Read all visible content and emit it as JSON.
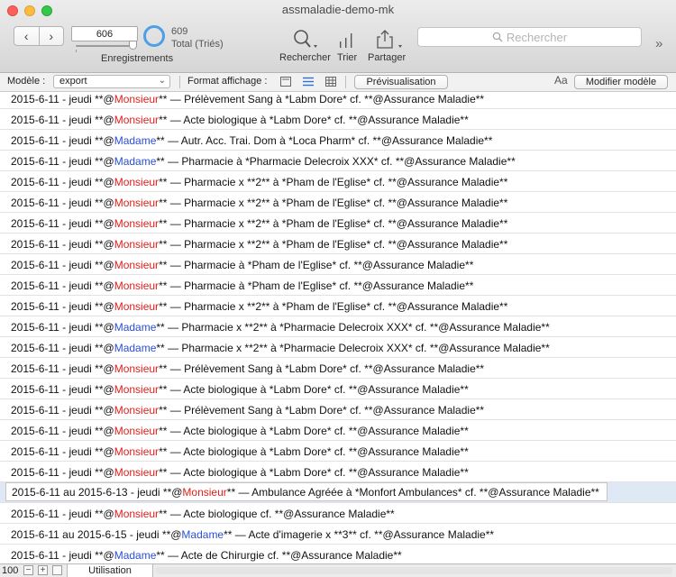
{
  "window": {
    "title": "assmaladie-demo-mk"
  },
  "toolbar": {
    "current_record": "606",
    "records_label": "Enregistrements",
    "total_count": "609",
    "total_label": "Total (Triés)",
    "search_label": "Rechercher",
    "sort_label": "Trier",
    "share_label": "Partager",
    "search_placeholder": "Rechercher",
    "overflow": "»"
  },
  "layoutbar": {
    "model_label": "Modèle :",
    "model_value": "export",
    "format_label": "Format affichage :",
    "preview_button": "Prévisualisation",
    "font_icon_text": "Aa",
    "edit_model_button": "Modifier modèle"
  },
  "records": [
    {
      "pre": "2015-6-11 - jeudi **@",
      "who": "Monsieur",
      "sex": "m",
      "post": "** — Prélèvement Sang à *Labm Dore* cf. **@Assurance Maladie**"
    },
    {
      "pre": "2015-6-11 - jeudi **@",
      "who": "Monsieur",
      "sex": "m",
      "post": "** — Acte biologique à *Labm Dore* cf. **@Assurance Maladie**"
    },
    {
      "pre": "2015-6-11 - jeudi **@",
      "who": "Madame",
      "sex": "f",
      "post": "** — Autr. Acc. Trai. Dom à *Loca Pharm* cf. **@Assurance Maladie**"
    },
    {
      "pre": "2015-6-11 - jeudi **@",
      "who": "Madame",
      "sex": "f",
      "post": "** — Pharmacie à *Pharmacie Delecroix XXX* cf. **@Assurance Maladie**"
    },
    {
      "pre": "2015-6-11 - jeudi **@",
      "who": "Monsieur",
      "sex": "m",
      "post": "** — Pharmacie x **2** à *Pham de l'Eglise* cf. **@Assurance Maladie**"
    },
    {
      "pre": "2015-6-11 - jeudi **@",
      "who": "Monsieur",
      "sex": "m",
      "post": "** — Pharmacie x **2** à *Pham de l'Eglise* cf. **@Assurance Maladie**"
    },
    {
      "pre": "2015-6-11 - jeudi **@",
      "who": "Monsieur",
      "sex": "m",
      "post": "** — Pharmacie x **2** à *Pham de l'Eglise* cf. **@Assurance Maladie**"
    },
    {
      "pre": "2015-6-11 - jeudi **@",
      "who": "Monsieur",
      "sex": "m",
      "post": "** — Pharmacie x **2** à *Pham de l'Eglise* cf. **@Assurance Maladie**"
    },
    {
      "pre": "2015-6-11 - jeudi **@",
      "who": "Monsieur",
      "sex": "m",
      "post": "** — Pharmacie à *Pham de l'Eglise* cf. **@Assurance Maladie**"
    },
    {
      "pre": "2015-6-11 - jeudi **@",
      "who": "Monsieur",
      "sex": "m",
      "post": "** — Pharmacie à *Pham de l'Eglise* cf. **@Assurance Maladie**"
    },
    {
      "pre": "2015-6-11 - jeudi **@",
      "who": "Monsieur",
      "sex": "m",
      "post": "** — Pharmacie x **2** à *Pham de l'Eglise* cf. **@Assurance Maladie**"
    },
    {
      "pre": "2015-6-11 - jeudi **@",
      "who": "Madame",
      "sex": "f",
      "post": "** — Pharmacie x **2** à *Pharmacie Delecroix XXX* cf. **@Assurance Maladie**"
    },
    {
      "pre": "2015-6-11 - jeudi **@",
      "who": "Madame",
      "sex": "f",
      "post": "** — Pharmacie x **2** à *Pharmacie Delecroix XXX* cf. **@Assurance Maladie**"
    },
    {
      "pre": "2015-6-11 - jeudi **@",
      "who": "Monsieur",
      "sex": "m",
      "post": "** — Prélèvement Sang à *Labm Dore* cf. **@Assurance Maladie**"
    },
    {
      "pre": "2015-6-11 - jeudi **@",
      "who": "Monsieur",
      "sex": "m",
      "post": "** — Acte biologique à *Labm Dore* cf. **@Assurance Maladie**"
    },
    {
      "pre": "2015-6-11 - jeudi **@",
      "who": "Monsieur",
      "sex": "m",
      "post": "** — Prélèvement Sang à *Labm Dore* cf. **@Assurance Maladie**"
    },
    {
      "pre": "2015-6-11 - jeudi **@",
      "who": "Monsieur",
      "sex": "m",
      "post": "** — Acte biologique à *Labm Dore* cf. **@Assurance Maladie**"
    },
    {
      "pre": "2015-6-11 - jeudi **@",
      "who": "Monsieur",
      "sex": "m",
      "post": "** — Acte biologique à *Labm Dore* cf. **@Assurance Maladie**"
    },
    {
      "pre": "2015-6-11 - jeudi **@",
      "who": "Monsieur",
      "sex": "m",
      "post": "** — Acte biologique à *Labm Dore* cf. **@Assurance Maladie**"
    },
    {
      "pre": "2015-6-11 au 2015-6-13 - jeudi **@",
      "who": "Monsieur",
      "sex": "m",
      "post": "** — Ambulance Agréée à *Monfort Ambulances* cf. **@Assurance Maladie**",
      "active": true
    },
    {
      "pre": "2015-6-11 - jeudi **@",
      "who": "Monsieur",
      "sex": "m",
      "post": "** — Acte biologique cf. **@Assurance Maladie**"
    },
    {
      "pre": "2015-6-11 au 2015-6-15 - jeudi **@",
      "who": "Madame",
      "sex": "f",
      "post": "** — Acte d'imagerie x **3** cf. **@Assurance Maladie**"
    },
    {
      "pre": "2015-6-11 - jeudi **@",
      "who": "Madame",
      "sex": "f",
      "post": "** — Acte de Chirurgie cf. **@Assurance Maladie**"
    }
  ],
  "statusbar": {
    "zoom": "100",
    "minus": "−",
    "plus": "+",
    "mode": "Utilisation"
  },
  "colors": {
    "monsieur": "#e0201b",
    "madame": "#2a4fd6",
    "accent": "#4f9fe8"
  }
}
